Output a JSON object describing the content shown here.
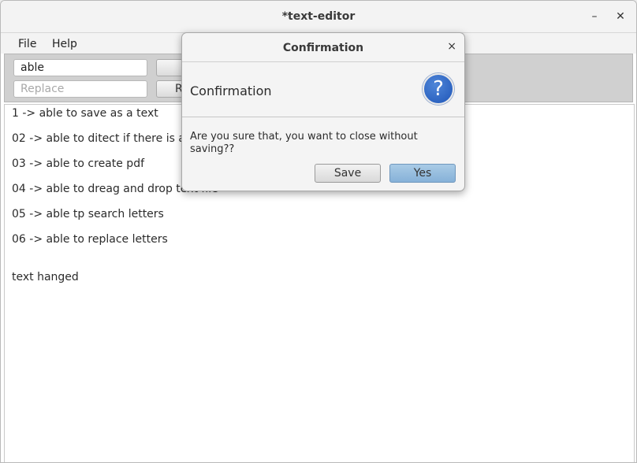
{
  "window": {
    "title": "*text-editor",
    "minimize_label": "–",
    "close_label": "✕"
  },
  "menu": {
    "items": [
      "File",
      "Help"
    ]
  },
  "toolbar": {
    "search_value": "able",
    "replace_placeholder": "Replace",
    "replace_button_label": "Replace"
  },
  "editor": {
    "lines": [
      "1 -> able to save as a text",
      "02 -> able to ditect if there is any",
      "03 -> able to create pdf",
      "04 -> able to dreag and drop text file",
      "05 -> able tp search letters",
      "06 -> able to replace letters",
      "text hanged"
    ]
  },
  "dialog": {
    "title": "Confirmation",
    "close_label": "×",
    "header": "Confirmation",
    "icon": "question-icon",
    "icon_glyph": "?",
    "message": "Are you sure that, you want to close without saving??",
    "buttons": {
      "save": "Save",
      "yes": "Yes"
    }
  },
  "colors": {
    "accent": "#1f56b8",
    "yes_button": "#96bde0",
    "toolbar_bg": "#d0d0d0"
  }
}
